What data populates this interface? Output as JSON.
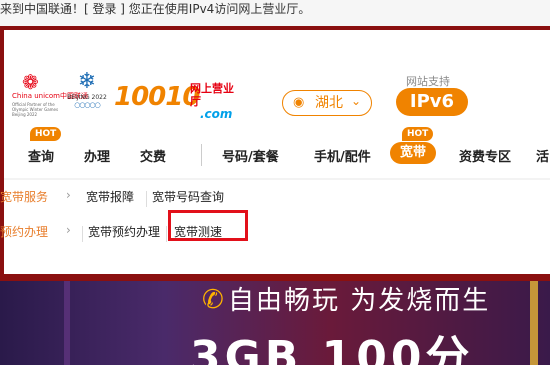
{
  "topbar": {
    "welcome": "来到中国联通！[ 登录 ]  您正在使用IPv4访问网上营业厅。"
  },
  "header": {
    "unicom_brand": "China unicom中国联通",
    "unicom_sub": "Official Partner of the Olympic Winter Games Beijing 2022",
    "olympic_text": "BEIJING 2022",
    "logo_number": "10010",
    "logo_cn": "网上营业厅",
    "logo_com": ".com",
    "province": "湖北",
    "ipv6_caption": "网站支持",
    "ipv6_label": "IPv6"
  },
  "nav": {
    "hot_label": "HOT",
    "items": [
      {
        "label": "查询"
      },
      {
        "label": "办理"
      },
      {
        "label": "交费"
      },
      {
        "label": "号码/套餐"
      },
      {
        "label": "手机/配件"
      },
      {
        "label": "宽带"
      },
      {
        "label": "资费专区"
      },
      {
        "label": "活"
      }
    ]
  },
  "submenu": {
    "rows": [
      {
        "category": "宽带服务",
        "links": [
          "宽带报障",
          "宽带号码查询"
        ]
      },
      {
        "category": "预约办理",
        "links": [
          "宽带预约办理",
          "宽带测速"
        ]
      }
    ]
  },
  "banner": {
    "slogan": "自由畅玩  为发烧而生",
    "big_text": "3GB  100分"
  },
  "colors": {
    "accent": "#f08300",
    "brand_red": "#e60012",
    "highlight_box": "#e2101a"
  }
}
